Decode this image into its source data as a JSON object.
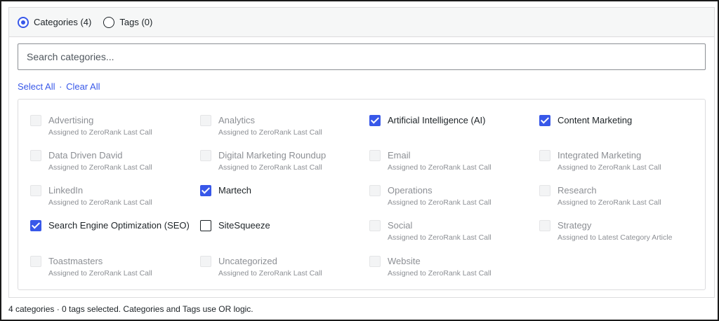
{
  "mode_toggle": {
    "categories_label": "Categories (4)",
    "tags_label": "Tags (0)",
    "selected": "categories"
  },
  "search": {
    "placeholder": "Search categories...",
    "value": ""
  },
  "bulk_actions": {
    "select_all": "Select All",
    "separator": "·",
    "clear_all": "Clear All"
  },
  "categories": [
    {
      "name": "Advertising",
      "note": "Assigned to ZeroRank Last Call",
      "checked": false,
      "disabled": true
    },
    {
      "name": "Analytics",
      "note": "Assigned to ZeroRank Last Call",
      "checked": false,
      "disabled": true
    },
    {
      "name": "Artificial Intelligence (AI)",
      "note": "",
      "checked": true,
      "disabled": false
    },
    {
      "name": "Content Marketing",
      "note": "",
      "checked": true,
      "disabled": false
    },
    {
      "name": "Data Driven David",
      "note": "Assigned to ZeroRank Last Call",
      "checked": false,
      "disabled": true
    },
    {
      "name": "Digital Marketing Roundup",
      "note": "Assigned to ZeroRank Last Call",
      "checked": false,
      "disabled": true
    },
    {
      "name": "Email",
      "note": "Assigned to ZeroRank Last Call",
      "checked": false,
      "disabled": true
    },
    {
      "name": "Integrated Marketing",
      "note": "Assigned to ZeroRank Last Call",
      "checked": false,
      "disabled": true
    },
    {
      "name": "LinkedIn",
      "note": "Assigned to ZeroRank Last Call",
      "checked": false,
      "disabled": true
    },
    {
      "name": "Martech",
      "note": "",
      "checked": true,
      "disabled": false
    },
    {
      "name": "Operations",
      "note": "Assigned to ZeroRank Last Call",
      "checked": false,
      "disabled": true
    },
    {
      "name": "Research",
      "note": "Assigned to ZeroRank Last Call",
      "checked": false,
      "disabled": true
    },
    {
      "name": "Search Engine Optimization (SEO)",
      "note": "",
      "checked": true,
      "disabled": false
    },
    {
      "name": "SiteSqueeze",
      "note": "",
      "checked": false,
      "disabled": false
    },
    {
      "name": "Social",
      "note": "Assigned to ZeroRank Last Call",
      "checked": false,
      "disabled": true
    },
    {
      "name": "Strategy",
      "note": "Assigned to Latest Category Article",
      "checked": false,
      "disabled": true
    },
    {
      "name": "Toastmasters",
      "note": "Assigned to ZeroRank Last Call",
      "checked": false,
      "disabled": true
    },
    {
      "name": "Uncategorized",
      "note": "Assigned to ZeroRank Last Call",
      "checked": false,
      "disabled": true
    },
    {
      "name": "Website",
      "note": "Assigned to ZeroRank Last Call",
      "checked": false,
      "disabled": true
    }
  ],
  "footer": {
    "summary": "4 categories · 0 tags selected. Categories and Tags use OR logic."
  },
  "colors": {
    "accent": "#3858e9",
    "disabled_text": "#8c8f94"
  }
}
